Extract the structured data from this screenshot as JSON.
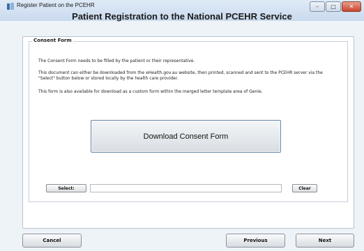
{
  "window": {
    "title": "Register Patient on the PCEHR",
    "main_title": "Patient Registration to the National PCEHR Service",
    "controls": {
      "minimize": "–",
      "maximize": "□",
      "close": "✕"
    }
  },
  "consent": {
    "legend": "Consent Form",
    "para1": "The Consent Form needs to be filled by the patient or their representative.",
    "para2": "This document can either be downloaded from the eHealth.gov.au website, then printed, scanned and sent to the PCEHR server via the \"Select\" button below or stored locally by the health care provider.",
    "para3": "This form is also available for download as a custom form within the merged letter template area of Genie.",
    "download_label": "Download Consent Form",
    "select_label": "Select:",
    "file_value": "",
    "clear_label": "Clear"
  },
  "footer": {
    "cancel_label": "Cancel",
    "previous_label": "Previous",
    "next_label": "Next"
  }
}
